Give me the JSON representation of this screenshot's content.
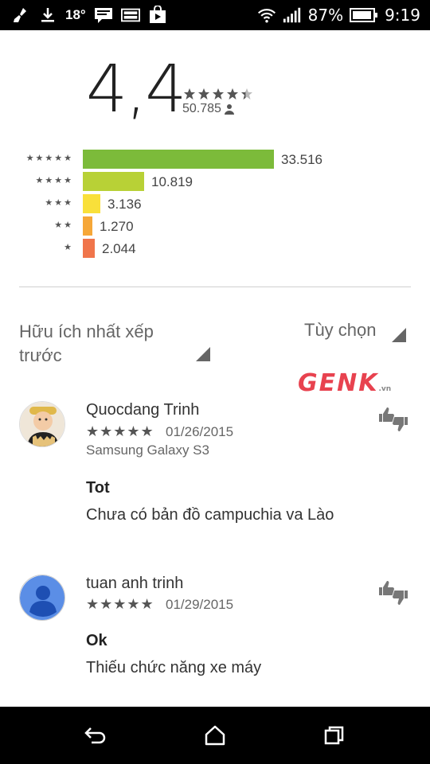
{
  "status_bar": {
    "temperature": "18°",
    "battery_percent": "87%",
    "time": "9:19",
    "icons": [
      "broom-icon",
      "download-icon",
      "message-icon",
      "gallery-icon",
      "play-store-bag-icon",
      "wifi-icon",
      "signal-icon",
      "battery-icon"
    ]
  },
  "rating": {
    "average": "4,4",
    "stars_value": 4.4,
    "total_reviews": "50.785",
    "histogram": [
      {
        "stars": 5,
        "star_glyphs": "★★★★★",
        "count": "33.516",
        "value": 33516,
        "color": "#7cbb3a"
      },
      {
        "stars": 4,
        "star_glyphs": "★★★★",
        "count": "10.819",
        "value": 10819,
        "color": "#b8d136"
      },
      {
        "stars": 3,
        "star_glyphs": "★★★",
        "count": "3.136",
        "value": 3136,
        "color": "#f9e03a"
      },
      {
        "stars": 2,
        "star_glyphs": "★★",
        "count": "1.270",
        "value": 1270,
        "color": "#f6a738"
      },
      {
        "stars": 1,
        "star_glyphs": "★",
        "count": "2.044",
        "value": 2044,
        "color": "#f0754b"
      }
    ]
  },
  "controls": {
    "sort_label": "Hữu ích nhất xếp trước",
    "options_label": "Tùy chọn"
  },
  "watermark": {
    "text": "GENK",
    "suffix": ".vn"
  },
  "reviews": [
    {
      "name": "Quocdang Trinh",
      "stars": "★★★★★",
      "date": "01/26/2015",
      "device": "Samsung Galaxy S3",
      "title": "Tot",
      "body": "Chưa có bản đồ campuchia va Lào"
    },
    {
      "name": "tuan anh trinh",
      "stars": "★★★★★",
      "date": "01/29/2015",
      "device": "",
      "title": "Ok",
      "body": "Thiếu chức năng xe máy"
    }
  ]
}
